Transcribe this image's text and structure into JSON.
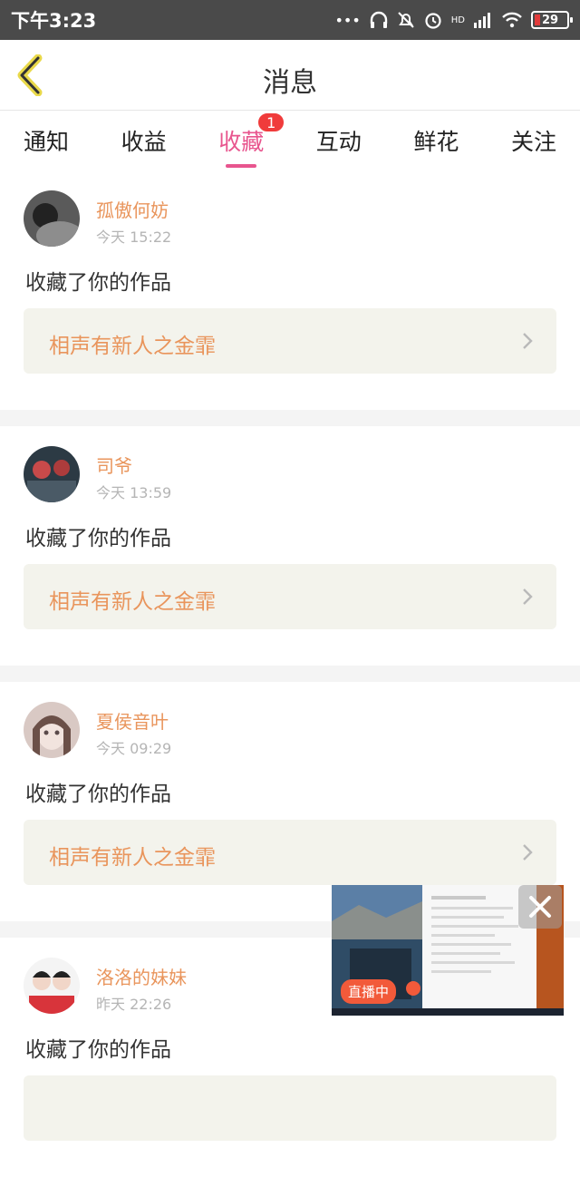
{
  "status_bar": {
    "time": "下午3:23",
    "battery": "29",
    "signal_label": "HD"
  },
  "navbar": {
    "title": "消息"
  },
  "tabs": [
    {
      "label": "通知"
    },
    {
      "label": "收益"
    },
    {
      "label": "收藏",
      "active": true,
      "badge": "1"
    },
    {
      "label": "互动"
    },
    {
      "label": "鲜花"
    },
    {
      "label": "关注"
    }
  ],
  "messages": [
    {
      "username": "孤傲何妨",
      "time": "今天 15:22",
      "action": "收藏了你的作品",
      "work_title": "相声有新人之金霏"
    },
    {
      "username": "司爷",
      "time": "今天 13:59",
      "action": "收藏了你的作品",
      "work_title": "相声有新人之金霏"
    },
    {
      "username": "夏侯音叶",
      "time": "今天 09:29",
      "action": "收藏了你的作品",
      "work_title": "相声有新人之金霏"
    },
    {
      "username": "洛洛的妹妹",
      "time": "昨天 22:26",
      "action": "收藏了你的作品",
      "work_title": ""
    }
  ],
  "mini_player": {
    "live_label": "直播中"
  },
  "colors": {
    "accent": "#e8558e",
    "username": "#e9955c",
    "badge": "#f03b3b",
    "status_bar_bg": "#4a4a4a",
    "link_bg": "#f3f3ec"
  }
}
